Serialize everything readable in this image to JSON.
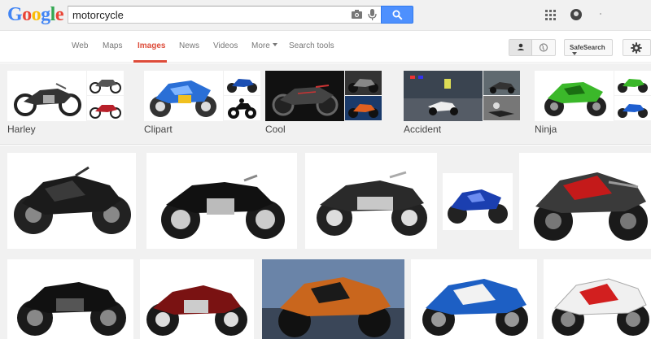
{
  "logo": {
    "letters": [
      "G",
      "o",
      "o",
      "g",
      "l",
      "e"
    ],
    "colors": [
      "#4285f4",
      "#ea4335",
      "#fbbc05",
      "#4285f4",
      "#34a853",
      "#ea4335"
    ]
  },
  "search": {
    "query": "motorcycle",
    "placeholder": ""
  },
  "nav": {
    "tabs": [
      {
        "label": "Web"
      },
      {
        "label": "Maps"
      },
      {
        "label": "Images"
      },
      {
        "label": "News"
      },
      {
        "label": "Videos"
      },
      {
        "label": "More"
      },
      {
        "label": "Search tools"
      }
    ],
    "active_tab": "Images",
    "safesearch_label": "SafeSearch"
  },
  "related": [
    {
      "label": "Harley"
    },
    {
      "label": "Clipart"
    },
    {
      "label": "Cool"
    },
    {
      "label": "Accident"
    },
    {
      "label": "Ninja"
    }
  ],
  "colors": {
    "accent_blue": "#4d90fe",
    "active_red": "#dd4b39",
    "bar_gray": "#f1f1f1"
  },
  "icons": [
    "camera-icon",
    "microphone-icon",
    "search-icon",
    "apps-grid-icon",
    "account-icon",
    "person-icon",
    "globe-icon",
    "gear-icon"
  ]
}
